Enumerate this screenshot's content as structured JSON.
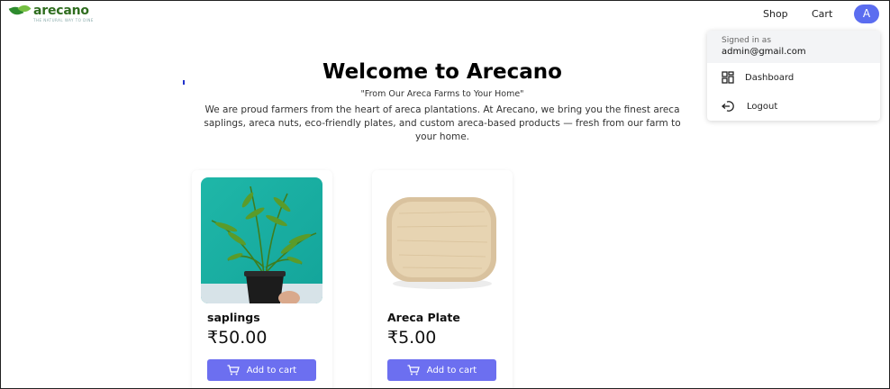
{
  "brand": {
    "name": "arecano",
    "tagline": "THE NATURAL WAY TO DINE"
  },
  "nav": {
    "shop": "Shop",
    "cart": "Cart",
    "avatar_initial": "A"
  },
  "account_menu": {
    "signed_in_label": "Signed in as",
    "email": "admin@gmail.com",
    "items": [
      {
        "label": "Dashboard",
        "icon": "dashboard-icon"
      },
      {
        "label": "Logout",
        "icon": "logout-icon"
      }
    ]
  },
  "hero": {
    "title": "Welcome to Arecano",
    "tagline": "\"From Our Areca Farms to Your Home\"",
    "description": "We are proud farmers from the heart of areca plantations. At Arecano, we bring you the finest areca saplings, areca nuts, eco-friendly plates, and custom areca-based products — fresh from our farm to your home."
  },
  "products": [
    {
      "name": "saplings",
      "price": "₹50.00",
      "button": "Add to cart"
    },
    {
      "name": "Areca Plate",
      "price": "₹5.00",
      "button": "Add to cart"
    }
  ],
  "colors": {
    "accent": "#6c6ff0",
    "avatar": "#5b6df0",
    "brand_green": "#2f6d1f"
  }
}
